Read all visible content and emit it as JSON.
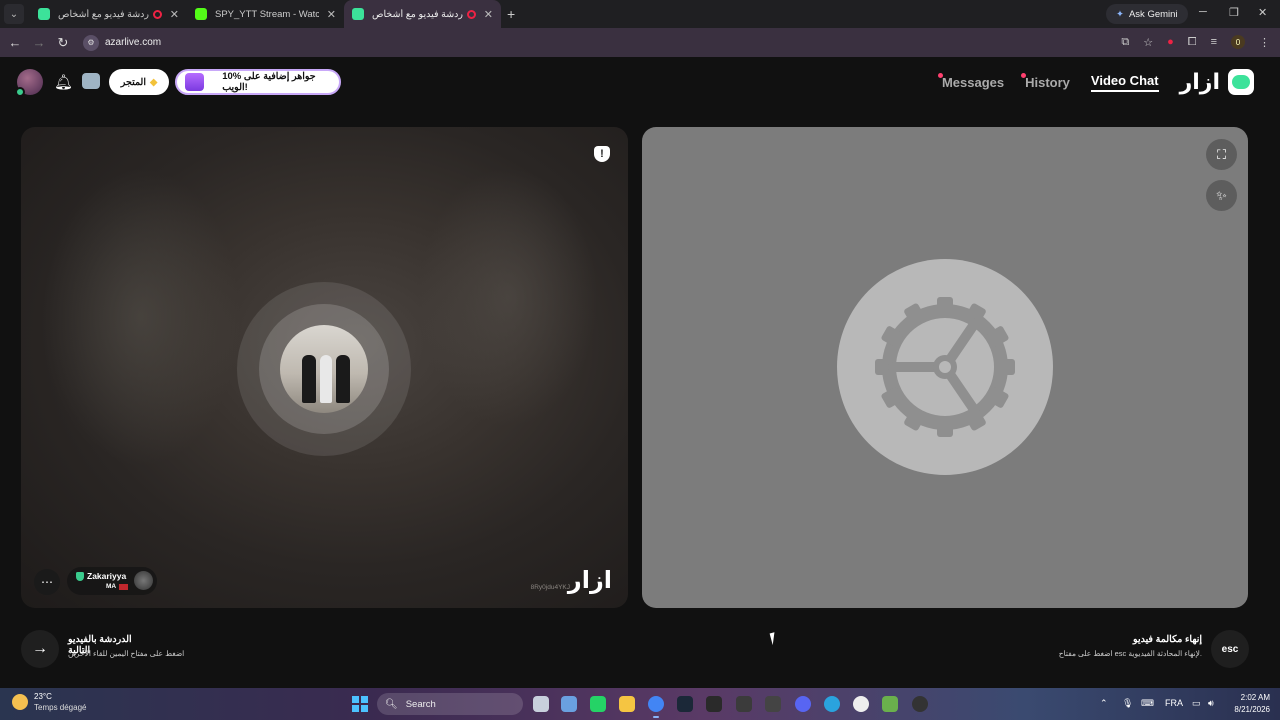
{
  "browser": {
    "tabs": [
      {
        "title": "أزاردردشة فيديو مع أشخاص",
        "favicon_color": "#3ce29a",
        "active": false
      },
      {
        "title": "SPY_YTT Stream - Watch Live o",
        "favicon_color": "#53fc18",
        "active": false
      },
      {
        "title": "أزاردردشة فيديو مع أشخاص",
        "favicon_color": "#3ce29a",
        "active": true
      }
    ],
    "new_tab_label": "+",
    "gemini_label": "Ask Gemini",
    "url": "azarlive.com",
    "extension_count": "0"
  },
  "header": {
    "store_label": "المتجر",
    "promo_label": "10% جواهر إضافية على الويب!",
    "nav": [
      {
        "label": "Messages",
        "has_dot": true,
        "active": false
      },
      {
        "label": "History",
        "has_dot": true,
        "active": false
      },
      {
        "label": "Video Chat",
        "has_dot": false,
        "active": true
      }
    ],
    "logo_text": "ازار"
  },
  "left_video": {
    "username": "Zakariyya",
    "country": "MA",
    "session_id": "8Ry0jdu4YKJ",
    "watermark": "ازار"
  },
  "bottom": {
    "next_title": "الدردشة بالفيديو التالية",
    "next_subtitle": "اضغط على مفتاح اليمين للقاء الآخرين",
    "end_title": "إنهاء مكالمة فيديو",
    "end_subtitle": "اضغط على مفتاح esc لإنهاء المحادثة الفيديوية.",
    "esc_label": "esc"
  },
  "taskbar": {
    "temperature": "23°C",
    "condition": "Temps dégagé",
    "search_label": "Search",
    "language": "FRA",
    "time": "2:02 AM",
    "date": "8/21/2026"
  },
  "colors": {
    "accent_green": "#3ce29a",
    "notification_dot": "#ff3f6e",
    "right_panel_bg": "#7c7c7c"
  }
}
